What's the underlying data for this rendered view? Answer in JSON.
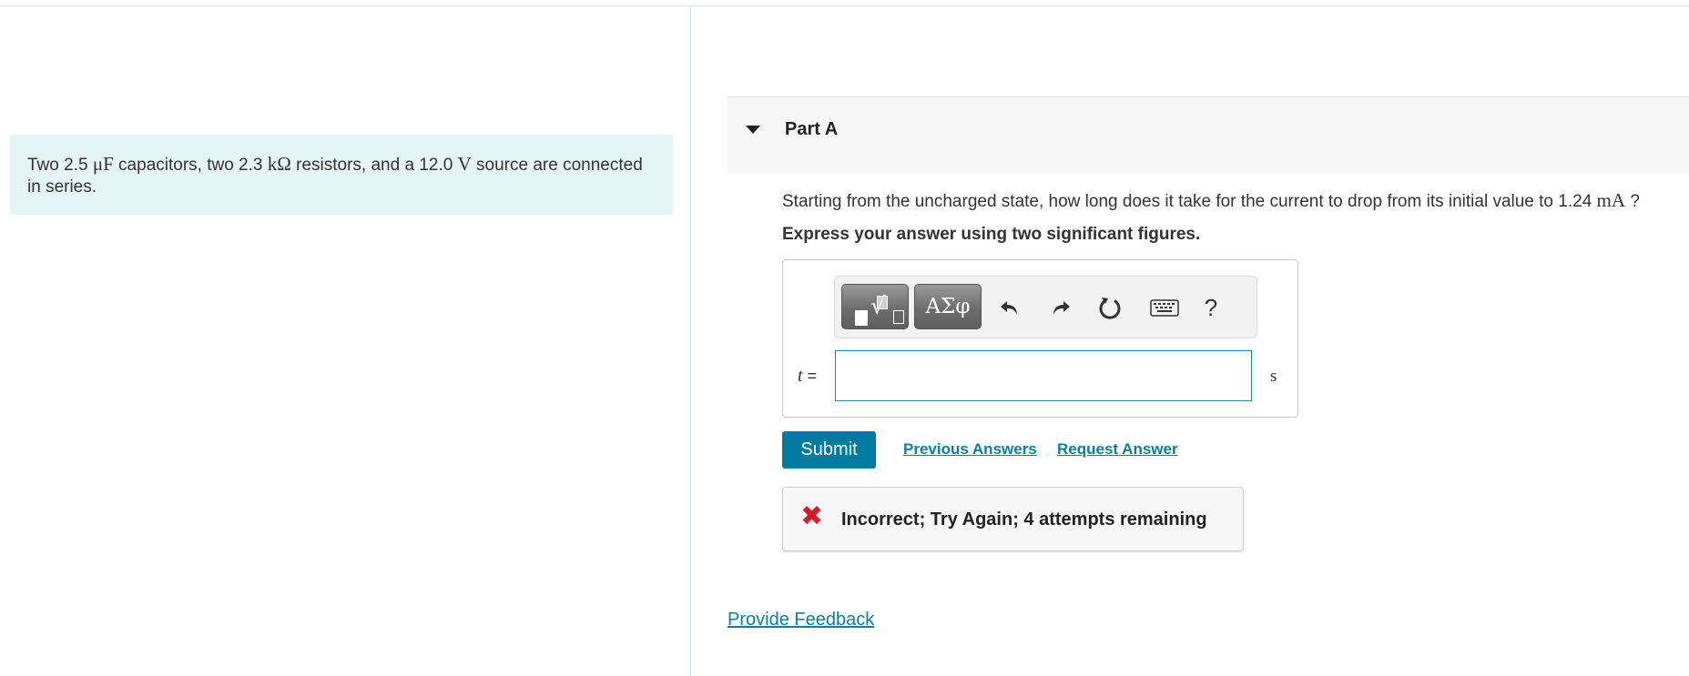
{
  "problem": {
    "text_prefix": "Two 2.5 ",
    "unit1": "μF",
    "text_mid1": " capacitors, two 2.3 ",
    "unit2": "kΩ",
    "text_mid2": " resistors, and a 12.0 ",
    "unit3": "V",
    "text_suffix": " source are connected in series."
  },
  "part": {
    "title": "Part A",
    "question_text": "Starting from the uncharged state, how long does it take for the current to drop from its initial value to 1.24 ",
    "question_unit": "mA",
    "question_end": " ?",
    "instruction": "Express your answer using two significant figures."
  },
  "toolbar": {
    "greek_label": "ΑΣφ",
    "help_label": "?",
    "icons": [
      "templates-icon",
      "greek-letters-icon",
      "undo-icon",
      "redo-icon",
      "reset-icon",
      "keyboard-icon",
      "help-icon"
    ]
  },
  "answer": {
    "variable": "t",
    "equals": " =",
    "value": "",
    "unit": "s"
  },
  "actions": {
    "submit_label": "Submit",
    "previous_answers_label": "Previous Answers",
    "request_answer_label": "Request Answer"
  },
  "feedback": {
    "message": "Incorrect; Try Again; 4 attempts remaining"
  },
  "footer": {
    "provide_feedback_label": "Provide Feedback"
  },
  "colors": {
    "accent": "#007b9e",
    "link": "#0b7ea0",
    "error": "#d41d2a",
    "problem_bg": "#e5f4f4"
  }
}
